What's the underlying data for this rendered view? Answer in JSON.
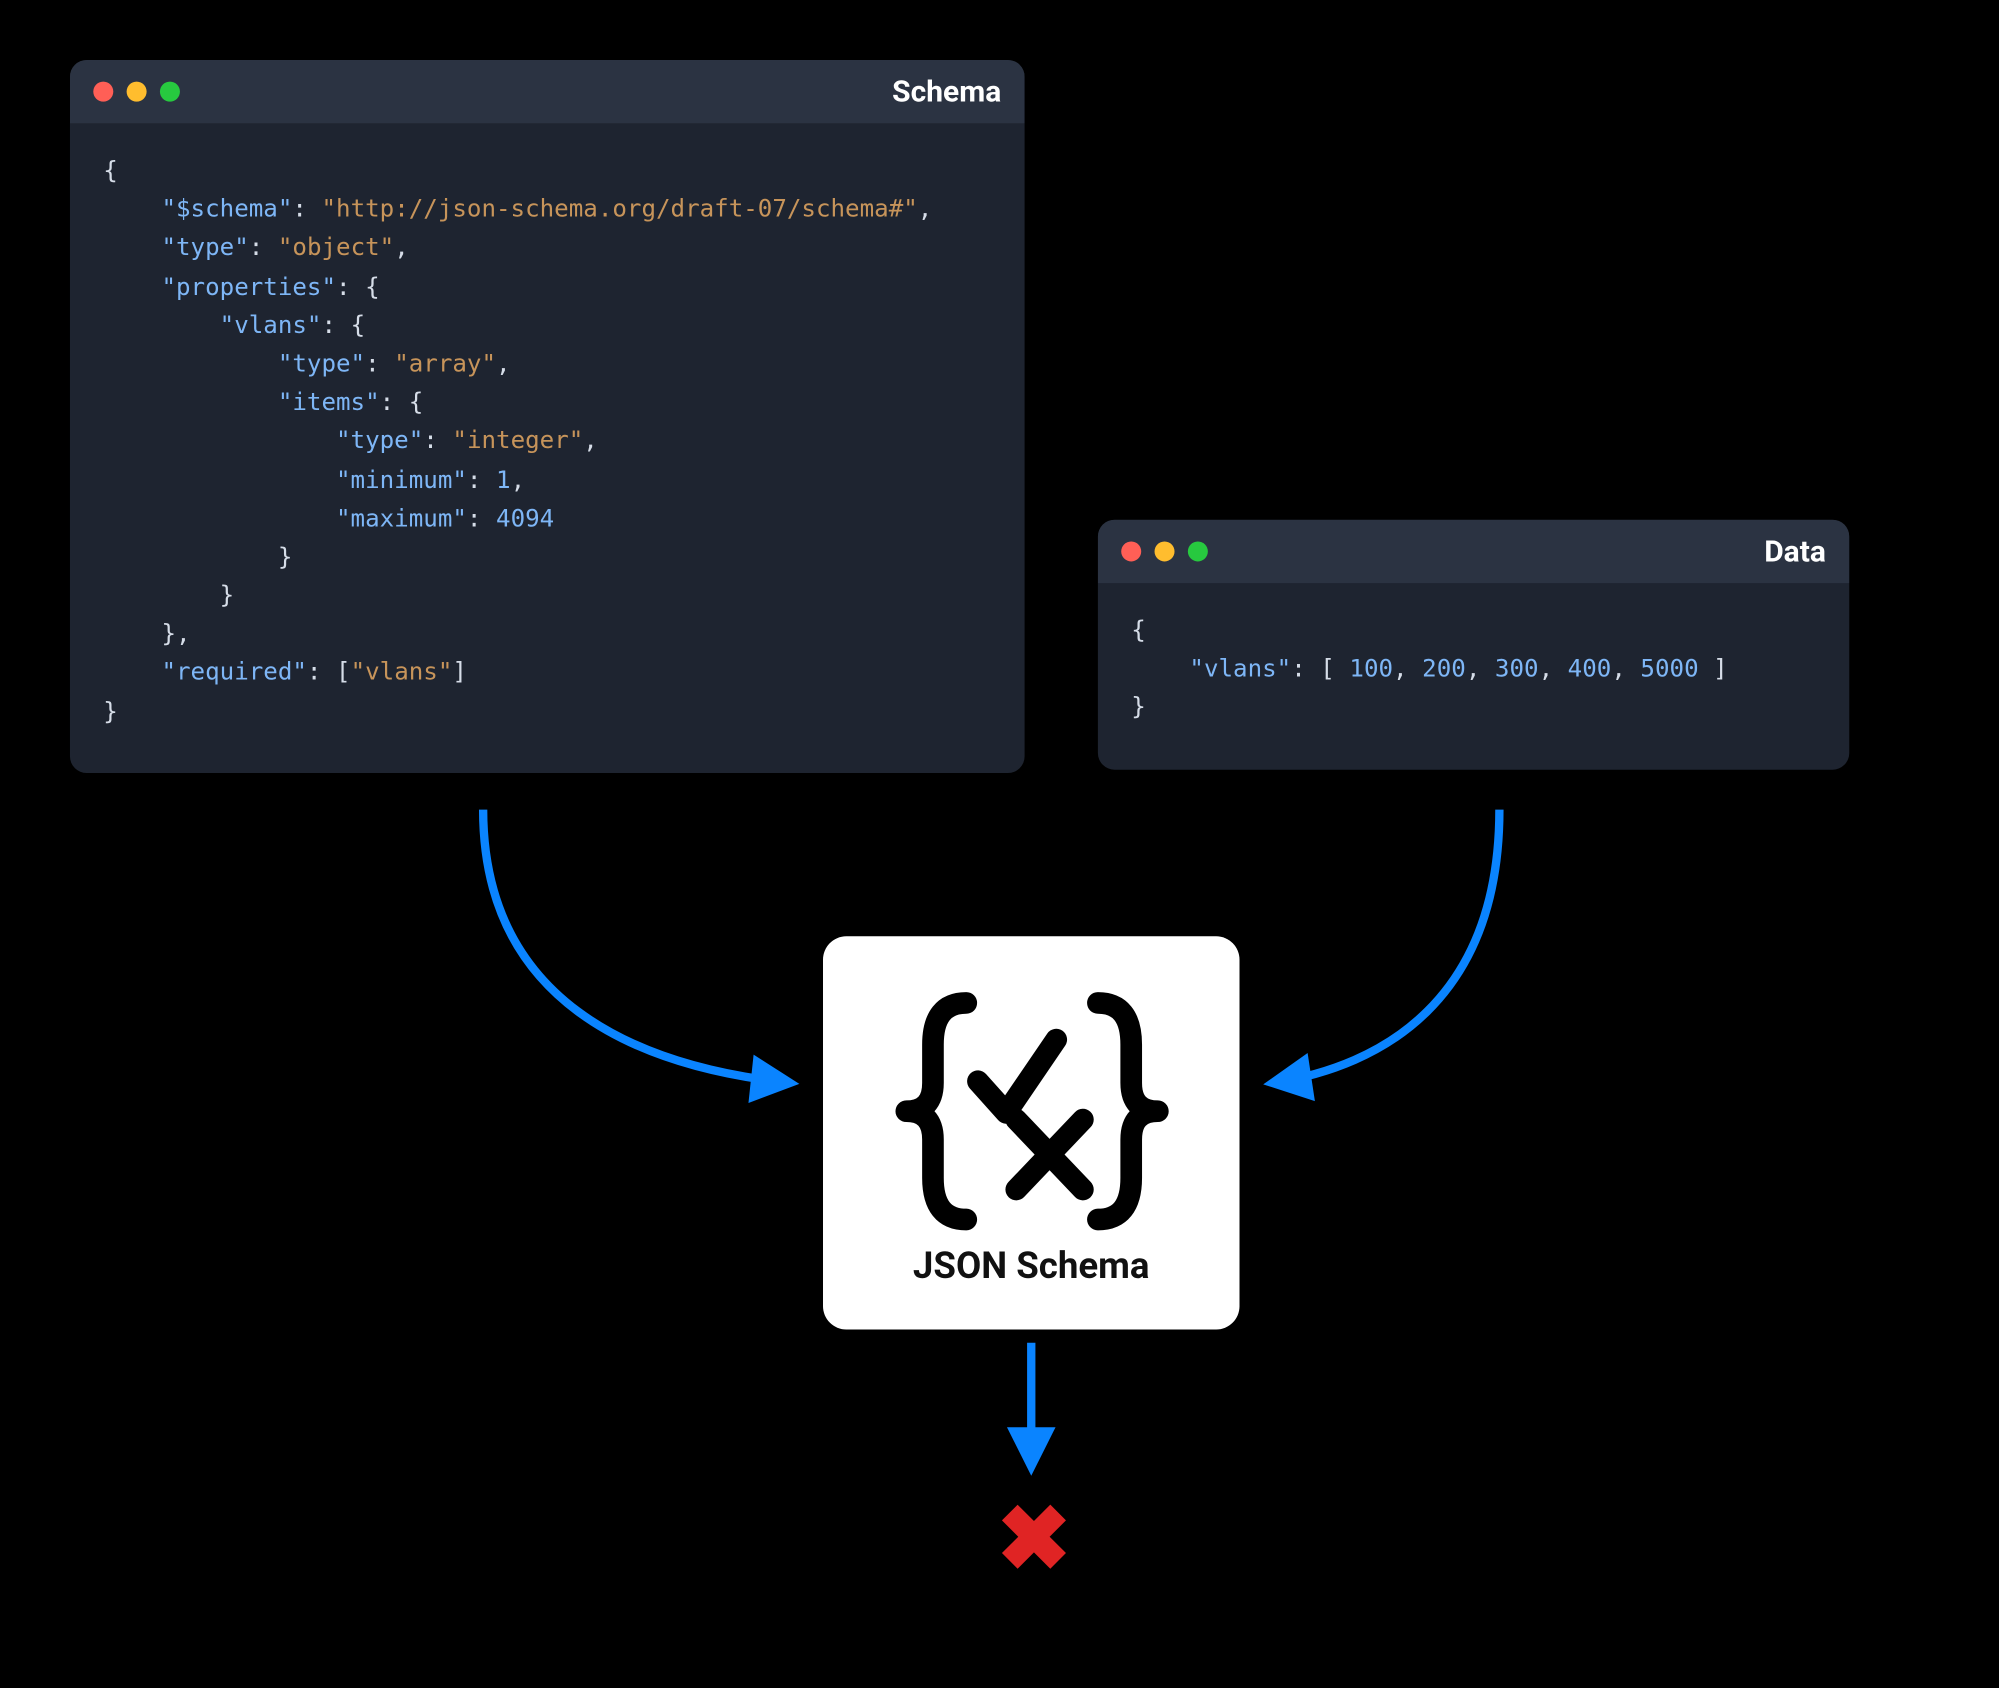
{
  "windows": {
    "schema": {
      "title": "Schema",
      "content_html": "<span class='t-punc'>{</span>\n    <span class='t-key'>\"$schema\"</span><span class='t-punc'>:</span> <span class='t-str'>\"http://json-schema.org/draft-07/schema#\"</span><span class='t-punc'>,</span>\n    <span class='t-key'>\"type\"</span><span class='t-punc'>:</span> <span class='t-str'>\"object\"</span><span class='t-punc'>,</span>\n    <span class='t-key'>\"properties\"</span><span class='t-punc'>:</span> <span class='t-punc'>{</span>\n        <span class='t-key'>\"vlans\"</span><span class='t-punc'>:</span> <span class='t-punc'>{</span>\n            <span class='t-key'>\"type\"</span><span class='t-punc'>:</span> <span class='t-str'>\"array\"</span><span class='t-punc'>,</span>\n            <span class='t-key'>\"items\"</span><span class='t-punc'>:</span> <span class='t-punc'>{</span>\n                <span class='t-key'>\"type\"</span><span class='t-punc'>:</span> <span class='t-str'>\"integer\"</span><span class='t-punc'>,</span>\n                <span class='t-key'>\"minimum\"</span><span class='t-punc'>:</span> <span class='t-num'>1</span><span class='t-punc'>,</span>\n                <span class='t-key'>\"maximum\"</span><span class='t-punc'>:</span> <span class='t-num'>4094</span>\n            <span class='t-punc'>}</span>\n        <span class='t-punc'>}</span>\n    <span class='t-punc'>},</span>\n    <span class='t-key'>\"required\"</span><span class='t-punc'>:</span> <span class='t-punc'>[</span><span class='t-str'>\"vlans\"</span><span class='t-punc'>]</span>\n<span class='t-punc'>}</span>"
    },
    "data": {
      "title": "Data",
      "content_html": "<span class='t-punc'>{</span>\n    <span class='t-key'>\"vlans\"</span><span class='t-punc'>:</span> <span class='t-punc'>[</span> <span class='t-num'>100</span><span class='t-punc'>,</span> <span class='t-num'>200</span><span class='t-punc'>,</span> <span class='t-num'>300</span><span class='t-punc'>,</span> <span class='t-num'>400</span><span class='t-punc'>,</span> <span class='t-num'>5000</span> <span class='t-punc'>]</span>\n<span class='t-punc'>}</span>"
    }
  },
  "validator": {
    "label": "JSON Schema"
  },
  "result": {
    "status": "fail",
    "glyph": "✖"
  },
  "schema_data": {
    "$schema": "http://json-schema.org/draft-07/schema#",
    "type": "object",
    "properties": {
      "vlans": {
        "type": "array",
        "items": {
          "type": "integer",
          "minimum": 1,
          "maximum": 4094
        }
      }
    },
    "required": [
      "vlans"
    ]
  },
  "instance_data": {
    "vlans": [
      100,
      200,
      300,
      400,
      5000
    ]
  }
}
